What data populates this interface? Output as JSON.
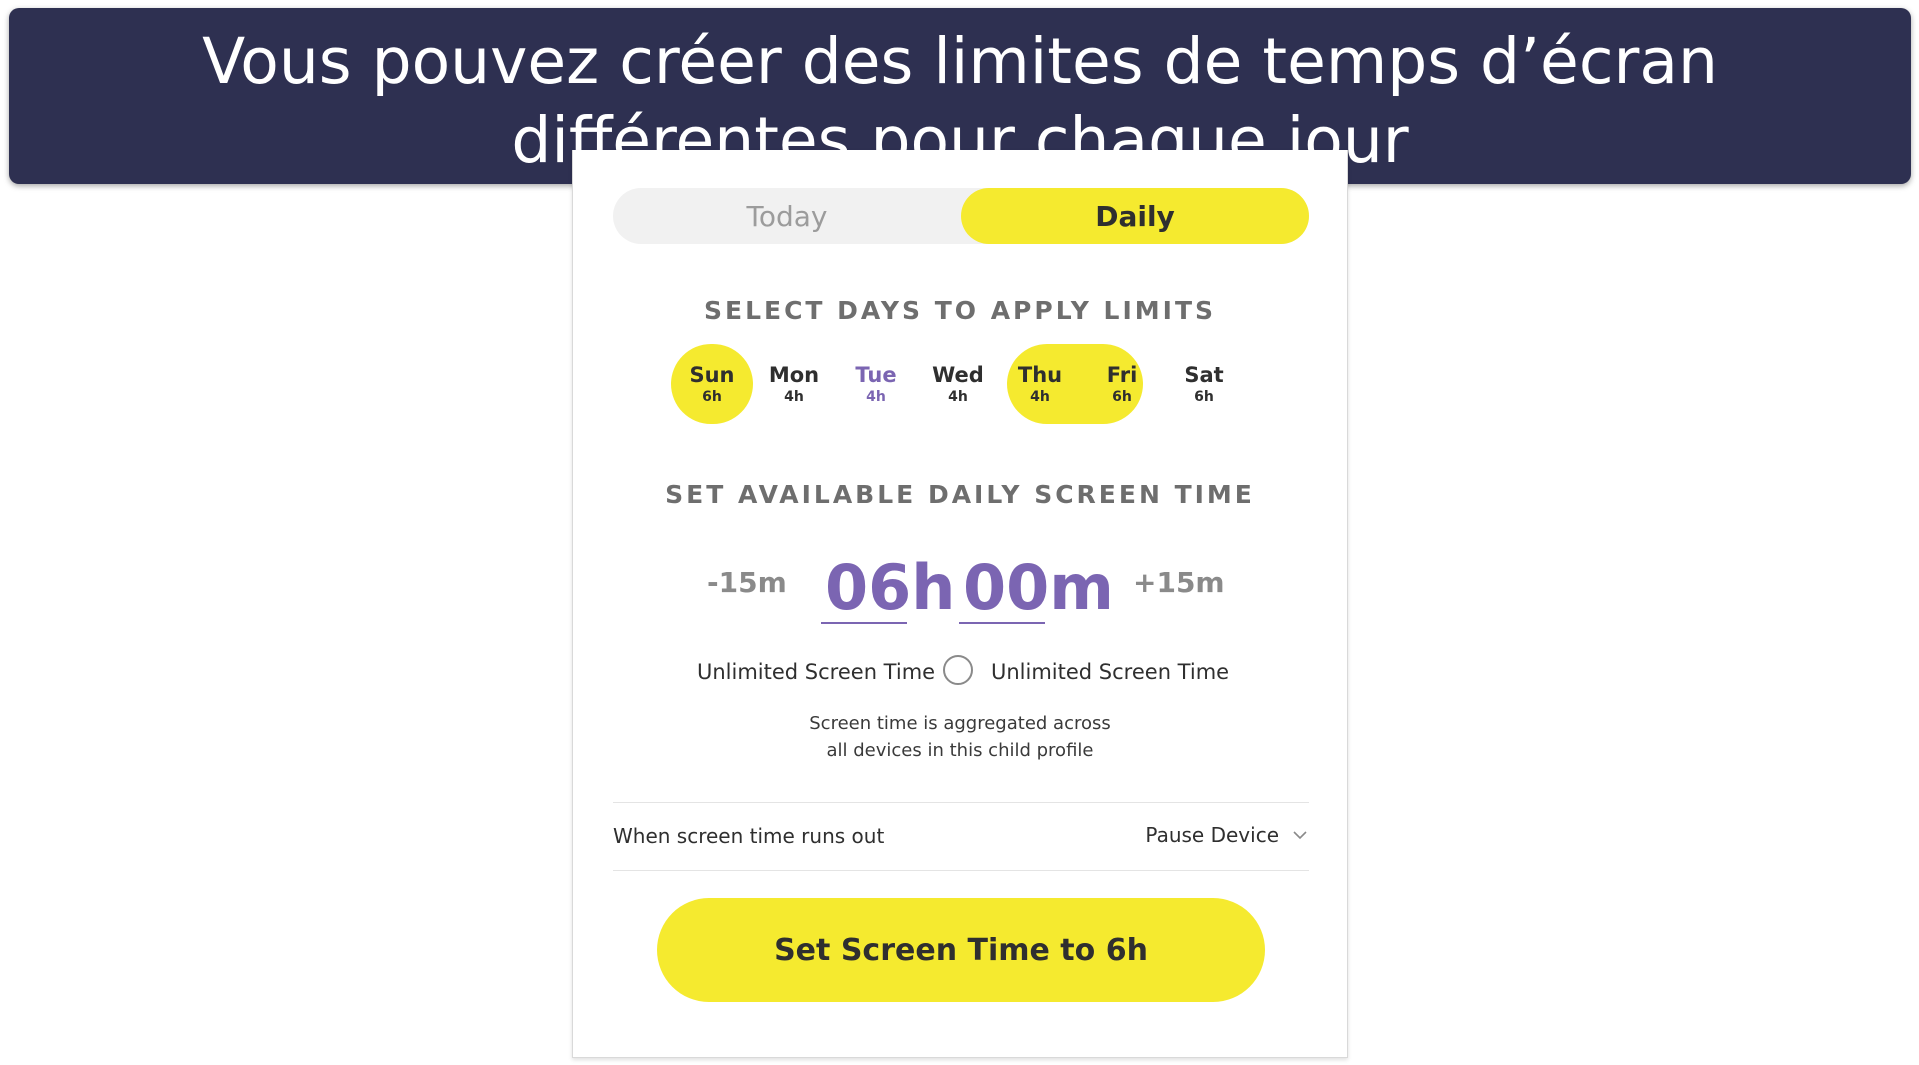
{
  "banner": {
    "line1": "Vous pouvez créer des limites de temps d’écran",
    "line2": "différentes pour chaque jour"
  },
  "tabs": {
    "today": "Today",
    "daily": "Daily",
    "selected": "Daily"
  },
  "days_section": {
    "title": "SELECT DAYS TO APPLY LIMITS",
    "days": [
      {
        "name": "Sun",
        "hours": "6h",
        "selected": true
      },
      {
        "name": "Mon",
        "hours": "4h",
        "selected": false
      },
      {
        "name": "Tue",
        "hours": "4h",
        "selected": false,
        "current": true
      },
      {
        "name": "Wed",
        "hours": "4h",
        "selected": false
      },
      {
        "name": "Thu",
        "hours": "4h",
        "selected": false
      },
      {
        "name": "Fri",
        "hours": "6h",
        "selected": true
      },
      {
        "name": "Sat",
        "hours": "6h",
        "selected": true
      }
    ]
  },
  "time_section": {
    "title": "SET AVAILABLE DAILY SCREEN TIME",
    "minus": "-15m",
    "plus": "+15m",
    "hours": "06h",
    "minutes": "00m"
  },
  "unlimited": {
    "left_label": "Unlimited Screen Time",
    "right_label": "Unlimited Screen Time",
    "checked": false
  },
  "note": {
    "line1": "Screen time is aggregated across",
    "line2": "all devices in this child profile"
  },
  "runout": {
    "label": "When screen time runs out",
    "value": "Pause Device"
  },
  "cta": {
    "label": "Set Screen Time to 6h"
  },
  "colors": {
    "accent_yellow": "#f5ea2f",
    "accent_purple": "#7b65b2",
    "banner_navy": "#2e3051"
  }
}
